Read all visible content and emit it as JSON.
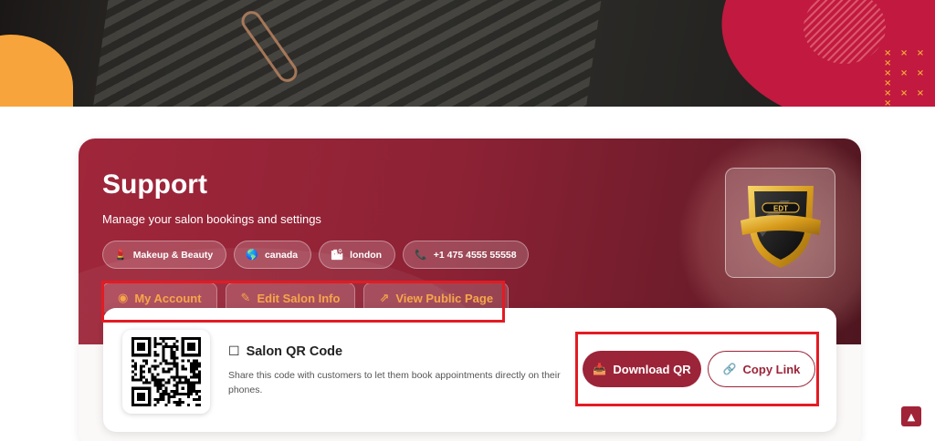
{
  "hero": {
    "decor_x": "× × × ×"
  },
  "profile": {
    "title": "Support",
    "subtitle": "Manage your salon bookings and settings",
    "chips": [
      {
        "icon": "lipstick-icon",
        "glyph": "💄",
        "label": "Makeup & Beauty"
      },
      {
        "icon": "globe-icon",
        "glyph": "🌎",
        "label": "canada"
      },
      {
        "icon": "cityscape-icon",
        "glyph": "🏙",
        "label": "london"
      },
      {
        "icon": "phone-icon",
        "glyph": "📞",
        "label": "+1 475 4555 55558"
      }
    ],
    "logo_text": "EDT"
  },
  "tabs": [
    {
      "icon": "user-circle-icon",
      "glyph": "◉",
      "label": "My Account"
    },
    {
      "icon": "edit-icon",
      "glyph": "✎",
      "label": "Edit Salon Info"
    },
    {
      "icon": "external-link-icon",
      "glyph": "⇗",
      "label": "View Public Page"
    }
  ],
  "qr": {
    "title_icon": "☐",
    "title": "Salon QR Code",
    "description": "Share this code with customers to let them book appointments directly on their phones.",
    "download_icon": "📥",
    "download_label": "Download QR",
    "copy_icon": "🔗",
    "copy_label": "Copy Link"
  },
  "scroll_top_glyph": "▲",
  "colors": {
    "brand": "#9c2438",
    "accent_orange": "#f7a64a",
    "highlight": "#e31b23"
  }
}
